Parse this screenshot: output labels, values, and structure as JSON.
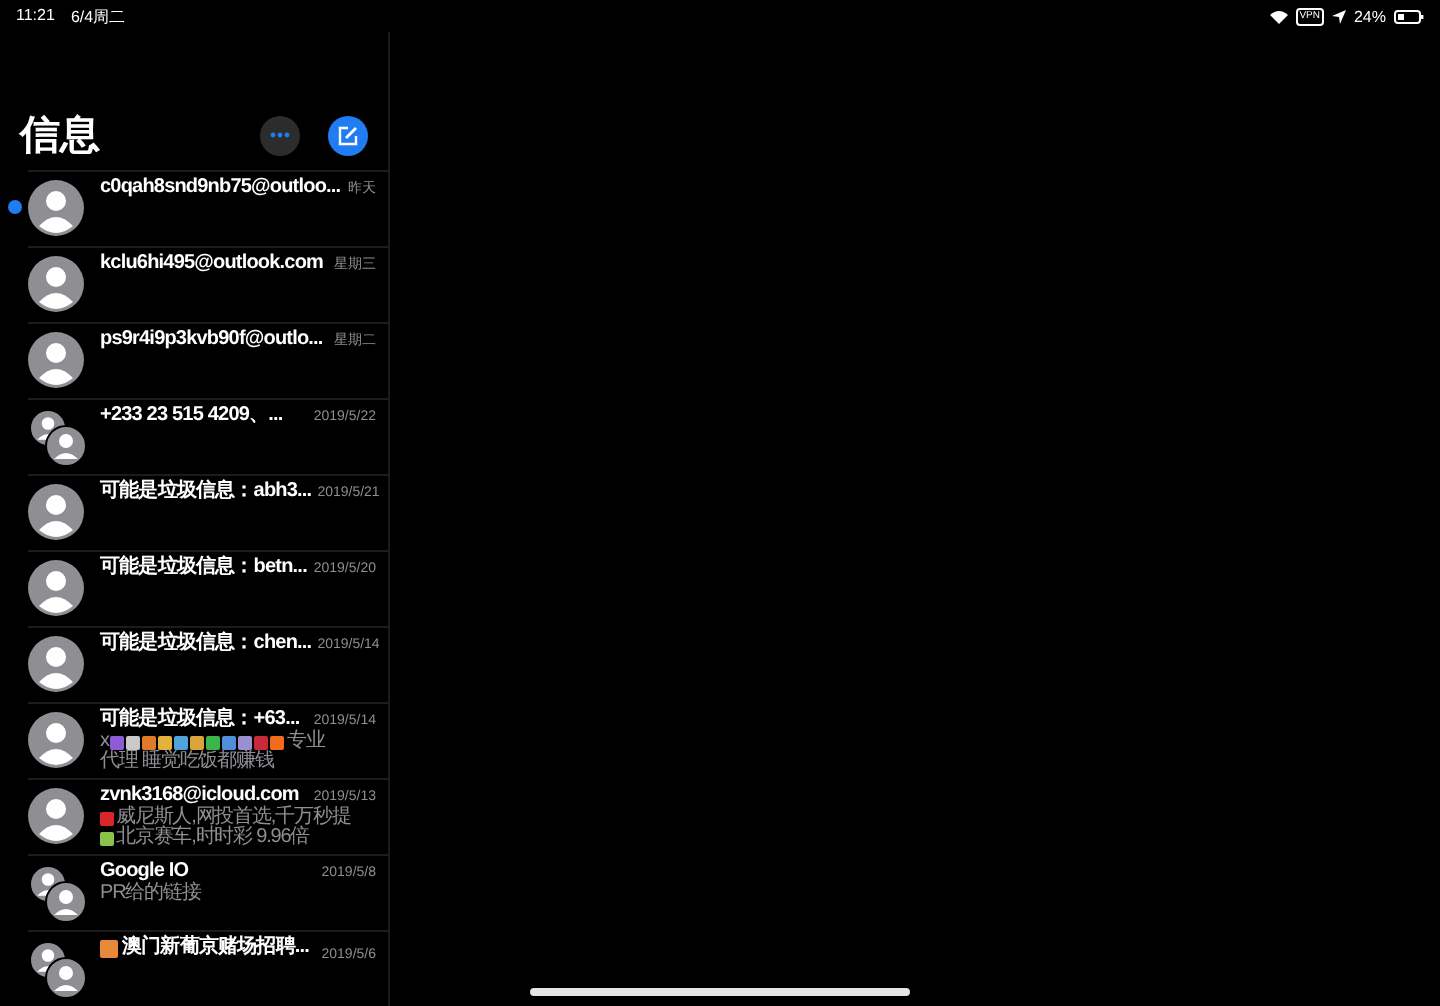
{
  "status_bar": {
    "time": "11:21",
    "date": "6/4周二",
    "vpn": "VPN",
    "battery": "24%"
  },
  "sidebar": {
    "title": "信息"
  },
  "conversations": [
    {
      "name": "c0qah8snd9nb75@outloo...",
      "date": "昨天",
      "unread": true,
      "kind": "single"
    },
    {
      "name": "kclu6hi495@outlook.com",
      "date": "星期三",
      "unread": false,
      "kind": "single"
    },
    {
      "name": "ps9r4i9p3kvb90f@outlo...",
      "date": "星期二",
      "unread": false,
      "kind": "single"
    },
    {
      "name": "+233 23 515 4209、...",
      "date": "2019/5/22",
      "unread": false,
      "kind": "group"
    },
    {
      "name": "可能是垃圾信息：abh3...",
      "date": "2019/5/21",
      "unread": false,
      "kind": "single"
    },
    {
      "name": "可能是垃圾信息：betn...",
      "date": "2019/5/20",
      "unread": false,
      "kind": "single"
    },
    {
      "name": "可能是垃圾信息：chen...",
      "date": "2019/5/14",
      "unread": false,
      "kind": "single"
    },
    {
      "name": "可能是垃圾信息：+63...",
      "date": "2019/5/14",
      "unread": false,
      "kind": "single",
      "preview": [
        [
          {
            "kind": "text",
            "text": "x"
          },
          {
            "kind": "emoji",
            "color": "#8e5bd6"
          },
          {
            "kind": "emoji",
            "color": "#c9c9c9"
          },
          {
            "kind": "emoji",
            "color": "#e07a2a"
          },
          {
            "kind": "emoji",
            "color": "#e3b23c"
          },
          {
            "kind": "emoji",
            "color": "#4fa3d9"
          },
          {
            "kind": "emoji",
            "color": "#d9a53a"
          },
          {
            "kind": "emoji",
            "color": "#3bb54a"
          },
          {
            "kind": "emoji",
            "color": "#4f8fd9"
          },
          {
            "kind": "emoji",
            "color": "#9a8fd0"
          },
          {
            "kind": "emoji",
            "color": "#c8283c"
          },
          {
            "kind": "emoji",
            "color": "#f26b1d"
          },
          {
            "kind": "text",
            "text": "专业"
          }
        ],
        [
          {
            "kind": "text",
            "text": "代理 睡觉吃饭都赚钱"
          }
        ]
      ]
    },
    {
      "name": "zvnk3168@icloud.com",
      "date": "2019/5/13",
      "unread": false,
      "kind": "single",
      "preview": [
        [
          {
            "kind": "emoji",
            "color": "#d8262a"
          },
          {
            "kind": "text",
            "text": "威尼斯人,网投首选,千万秒提"
          }
        ],
        [
          {
            "kind": "emoji",
            "color": "#8bc34a"
          },
          {
            "kind": "text",
            "text": "北京赛车,时时彩 9.96倍"
          }
        ]
      ]
    },
    {
      "name": "Google IO",
      "date": "2019/5/8",
      "unread": false,
      "kind": "group",
      "preview": [
        [
          {
            "kind": "text",
            "text": "PR给的链接"
          }
        ]
      ]
    },
    {
      "name": "澳门新葡京赌场招聘...",
      "date": "2019/5/6",
      "unread": false,
      "kind": "group",
      "title_emoji": {
        "color": "#e8893a"
      }
    }
  ]
}
